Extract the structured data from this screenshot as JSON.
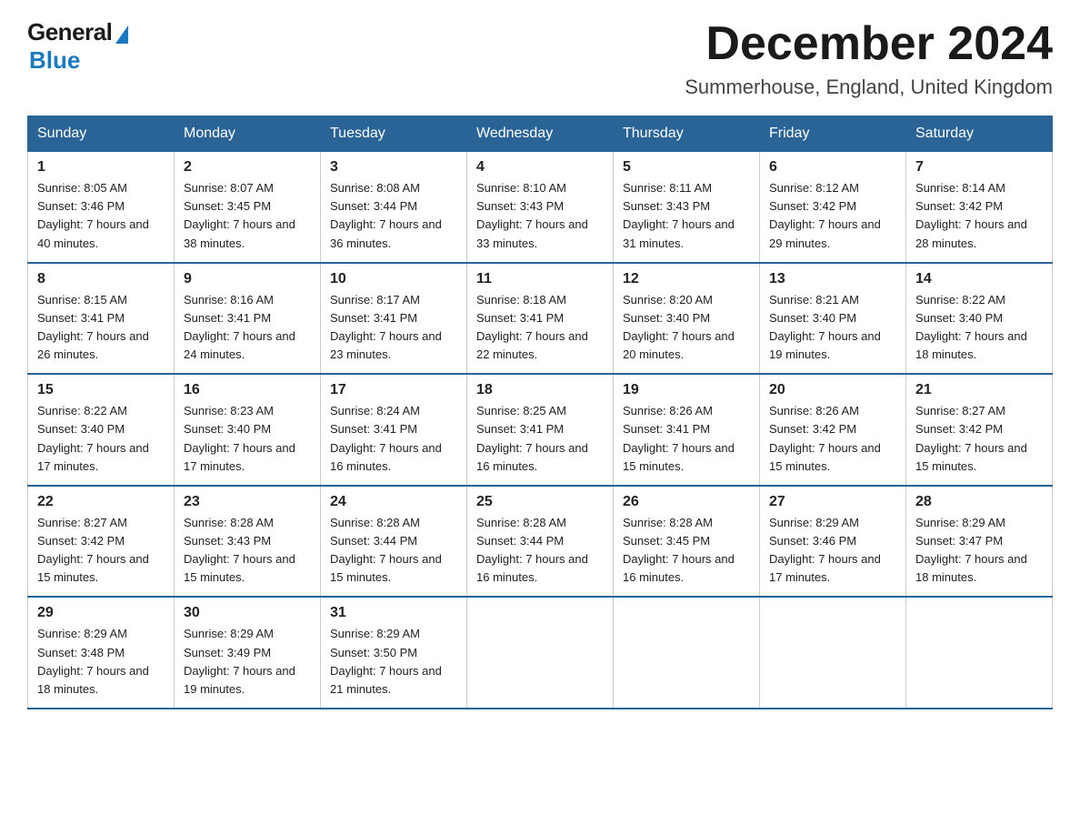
{
  "logo": {
    "general": "General",
    "blue": "Blue"
  },
  "title": "December 2024",
  "location": "Summerhouse, England, United Kingdom",
  "days_of_week": [
    "Sunday",
    "Monday",
    "Tuesday",
    "Wednesday",
    "Thursday",
    "Friday",
    "Saturday"
  ],
  "weeks": [
    [
      {
        "day": "1",
        "sunrise": "8:05 AM",
        "sunset": "3:46 PM",
        "daylight": "7 hours and 40 minutes."
      },
      {
        "day": "2",
        "sunrise": "8:07 AM",
        "sunset": "3:45 PM",
        "daylight": "7 hours and 38 minutes."
      },
      {
        "day": "3",
        "sunrise": "8:08 AM",
        "sunset": "3:44 PM",
        "daylight": "7 hours and 36 minutes."
      },
      {
        "day": "4",
        "sunrise": "8:10 AM",
        "sunset": "3:43 PM",
        "daylight": "7 hours and 33 minutes."
      },
      {
        "day": "5",
        "sunrise": "8:11 AM",
        "sunset": "3:43 PM",
        "daylight": "7 hours and 31 minutes."
      },
      {
        "day": "6",
        "sunrise": "8:12 AM",
        "sunset": "3:42 PM",
        "daylight": "7 hours and 29 minutes."
      },
      {
        "day": "7",
        "sunrise": "8:14 AM",
        "sunset": "3:42 PM",
        "daylight": "7 hours and 28 minutes."
      }
    ],
    [
      {
        "day": "8",
        "sunrise": "8:15 AM",
        "sunset": "3:41 PM",
        "daylight": "7 hours and 26 minutes."
      },
      {
        "day": "9",
        "sunrise": "8:16 AM",
        "sunset": "3:41 PM",
        "daylight": "7 hours and 24 minutes."
      },
      {
        "day": "10",
        "sunrise": "8:17 AM",
        "sunset": "3:41 PM",
        "daylight": "7 hours and 23 minutes."
      },
      {
        "day": "11",
        "sunrise": "8:18 AM",
        "sunset": "3:41 PM",
        "daylight": "7 hours and 22 minutes."
      },
      {
        "day": "12",
        "sunrise": "8:20 AM",
        "sunset": "3:40 PM",
        "daylight": "7 hours and 20 minutes."
      },
      {
        "day": "13",
        "sunrise": "8:21 AM",
        "sunset": "3:40 PM",
        "daylight": "7 hours and 19 minutes."
      },
      {
        "day": "14",
        "sunrise": "8:22 AM",
        "sunset": "3:40 PM",
        "daylight": "7 hours and 18 minutes."
      }
    ],
    [
      {
        "day": "15",
        "sunrise": "8:22 AM",
        "sunset": "3:40 PM",
        "daylight": "7 hours and 17 minutes."
      },
      {
        "day": "16",
        "sunrise": "8:23 AM",
        "sunset": "3:40 PM",
        "daylight": "7 hours and 17 minutes."
      },
      {
        "day": "17",
        "sunrise": "8:24 AM",
        "sunset": "3:41 PM",
        "daylight": "7 hours and 16 minutes."
      },
      {
        "day": "18",
        "sunrise": "8:25 AM",
        "sunset": "3:41 PM",
        "daylight": "7 hours and 16 minutes."
      },
      {
        "day": "19",
        "sunrise": "8:26 AM",
        "sunset": "3:41 PM",
        "daylight": "7 hours and 15 minutes."
      },
      {
        "day": "20",
        "sunrise": "8:26 AM",
        "sunset": "3:42 PM",
        "daylight": "7 hours and 15 minutes."
      },
      {
        "day": "21",
        "sunrise": "8:27 AM",
        "sunset": "3:42 PM",
        "daylight": "7 hours and 15 minutes."
      }
    ],
    [
      {
        "day": "22",
        "sunrise": "8:27 AM",
        "sunset": "3:42 PM",
        "daylight": "7 hours and 15 minutes."
      },
      {
        "day": "23",
        "sunrise": "8:28 AM",
        "sunset": "3:43 PM",
        "daylight": "7 hours and 15 minutes."
      },
      {
        "day": "24",
        "sunrise": "8:28 AM",
        "sunset": "3:44 PM",
        "daylight": "7 hours and 15 minutes."
      },
      {
        "day": "25",
        "sunrise": "8:28 AM",
        "sunset": "3:44 PM",
        "daylight": "7 hours and 16 minutes."
      },
      {
        "day": "26",
        "sunrise": "8:28 AM",
        "sunset": "3:45 PM",
        "daylight": "7 hours and 16 minutes."
      },
      {
        "day": "27",
        "sunrise": "8:29 AM",
        "sunset": "3:46 PM",
        "daylight": "7 hours and 17 minutes."
      },
      {
        "day": "28",
        "sunrise": "8:29 AM",
        "sunset": "3:47 PM",
        "daylight": "7 hours and 18 minutes."
      }
    ],
    [
      {
        "day": "29",
        "sunrise": "8:29 AM",
        "sunset": "3:48 PM",
        "daylight": "7 hours and 18 minutes."
      },
      {
        "day": "30",
        "sunrise": "8:29 AM",
        "sunset": "3:49 PM",
        "daylight": "7 hours and 19 minutes."
      },
      {
        "day": "31",
        "sunrise": "8:29 AM",
        "sunset": "3:50 PM",
        "daylight": "7 hours and 21 minutes."
      },
      null,
      null,
      null,
      null
    ]
  ]
}
